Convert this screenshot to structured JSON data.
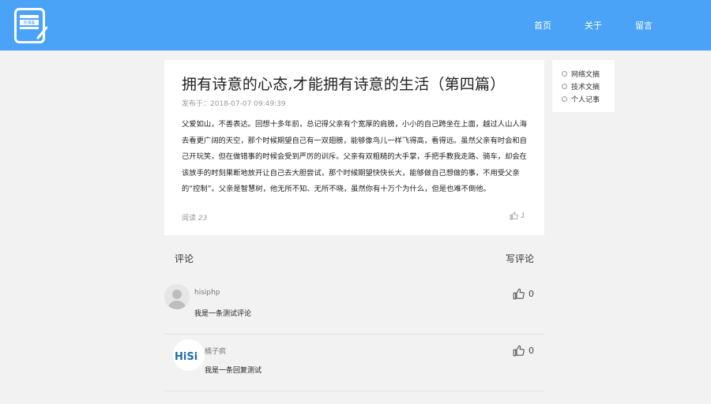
{
  "nav": {
    "logo_text": "资博客",
    "items": [
      {
        "label": "首页"
      },
      {
        "label": "关于"
      },
      {
        "label": "留言"
      }
    ]
  },
  "article": {
    "title": "拥有诗意的心态,才能拥有诗意的生活（第四篇）",
    "date_label": "发布于：",
    "date": "2018-07-07 09:49:39",
    "body": "父爱如山，不善表达。回想十多年前，总记得父亲有个宽厚的肩膀，小小的自己跨坐在上面，越过人山人海去看更广阔的天空，那个时候期望自己有一双翅膀，能够像鸟儿一样飞得高，看得远。虽然父亲有时会和自己开玩笑，但在做错事的时候会受到严厉的训斥。父亲有双粗糙的大手掌，手把手教我走路、骑车，却会在该放手的时刻果断地放开让自己去大胆尝试，那个时候期望快快长大，能够做自己想做的事，不用受父亲的“控制”。父亲是智慧树，他无所不知、无所不晓，虽然你有十万个为什么，但是也难不倒他。",
    "read_label": "阅读",
    "read_count": "23",
    "like_count": "1"
  },
  "sidebar": {
    "items": [
      {
        "label": "网络文摘"
      },
      {
        "label": "技术文摘"
      },
      {
        "label": "个人记事"
      }
    ]
  },
  "comments": {
    "title": "评论",
    "write_label": "写评论",
    "items": [
      {
        "user": "hisiphp",
        "text": "我是一条测试评论",
        "likes": "0",
        "avatar": "default-avatar"
      },
      {
        "user": "橘子疯",
        "text": "我是一条回复测试",
        "likes": "0",
        "avatar": "hisi-logo",
        "avatar_text": "HiSi"
      }
    ]
  },
  "colors": {
    "header_bg": "#4aa3f7",
    "page_bg": "#f2f2f2",
    "card_bg": "#ffffff"
  }
}
